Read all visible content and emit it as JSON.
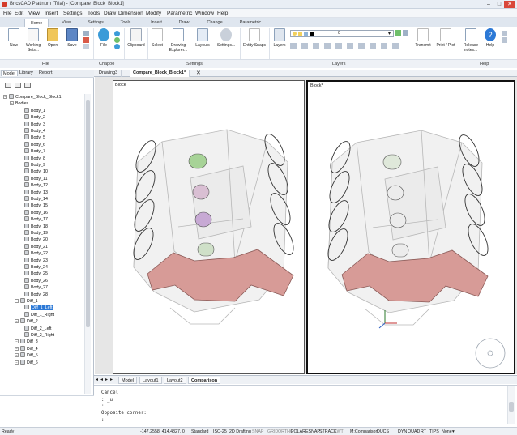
{
  "window": {
    "title": "BricsCAD Platinum (Trial) - [Compare_Block_Block1]",
    "min": "–",
    "max": "□",
    "close": "✕"
  },
  "menu": [
    "File",
    "Edit",
    "View",
    "Insert",
    "Settings",
    "Tools",
    "Draw",
    "Dimension",
    "Modify",
    "Parametric",
    "Window",
    "Help"
  ],
  "ribbon_tabs": [
    "Home",
    "View",
    "Settings",
    "Tools",
    "Insert",
    "Draw",
    "Change",
    "Parametric"
  ],
  "ribbon_tab_active": "Home",
  "ribbon": {
    "new": "New",
    "working_sets": "Working Sets...",
    "open": "Open",
    "save": "Save",
    "file": "File",
    "clipboard": "Clipboard",
    "select": "Select",
    "drawing_explorer": "Drawing Explorer...",
    "layouts": "Layouts",
    "settings": "Settings...",
    "entity_snaps": "Entity Snaps",
    "layers": "Layers",
    "layer_value": "0",
    "transmit": "Transmit",
    "print_plot": "Print / Plot",
    "release_notes": "Release notes...",
    "help": "Help"
  },
  "ribbon_groups": [
    "File",
    "Chapoo",
    "Settings",
    "Layers",
    "Help"
  ],
  "left_panel": {
    "tabs": [
      "Model",
      "Library",
      "Report"
    ],
    "root": "Compare_Block_Block1",
    "bodies_label": "Bodies",
    "bodies": [
      "Body_1",
      "Body_2",
      "Body_3",
      "Body_4",
      "Body_5",
      "Body_6",
      "Body_7",
      "Body_8",
      "Body_9",
      "Body_10",
      "Body_11",
      "Body_12",
      "Body_13",
      "Body_14",
      "Body_15",
      "Body_16",
      "Body_17",
      "Body_18",
      "Body_19",
      "Body_20",
      "Body_21",
      "Body_22",
      "Body_23",
      "Body_24",
      "Body_25",
      "Body_26",
      "Body_27",
      "Body_28"
    ],
    "diff1": "Diff_1",
    "diff1_children": [
      "Diff_1_Left",
      "Diff_1_Right"
    ],
    "diff1_selected": "Diff_1_Left",
    "diff2": "Diff_2",
    "diff2_children": [
      "Diff_2_Left",
      "Diff_2_Right"
    ],
    "more_diffs": [
      "Diff_3",
      "Diff_4",
      "Diff_5",
      "Diff_6"
    ]
  },
  "doc_tabs": [
    {
      "label": "Drawing3",
      "active": false
    },
    {
      "label": "Compare_Block_Block1*",
      "active": true
    }
  ],
  "viewports": {
    "left_label": "Block",
    "right_label": "Block*"
  },
  "layout_tabs": [
    {
      "label": "Model",
      "active": false
    },
    {
      "label": "Layout1",
      "active": false
    },
    {
      "label": "Layout2",
      "active": false
    },
    {
      "label": "Comparison",
      "active": true
    }
  ],
  "command_lines": [
    "Cancel",
    ": _u",
    ":",
    "Opposite corner:",
    ":"
  ],
  "status": {
    "ready": "Ready",
    "coords": "-147.2558, 414.4827, 0",
    "items": [
      "Standard",
      "ISO-25",
      "2D Drafting",
      "SNAP",
      "GRID",
      "ORTHO",
      "POLAR",
      "ESNAP",
      "STRACK",
      "LWT",
      "M:Comparison",
      "DUCS",
      "DYN",
      "QUAD",
      "RT",
      "TIPS",
      "None"
    ],
    "off_items": [
      "SNAP",
      "GRID",
      "ORTHO",
      "LWT"
    ]
  },
  "colors": {
    "accent": "#2c79d6",
    "diff_pink": "#d79b97",
    "diff_green": "#a7d397",
    "diff_violet": "#c7a9d4",
    "diff_olive": "#c9cc7f"
  }
}
